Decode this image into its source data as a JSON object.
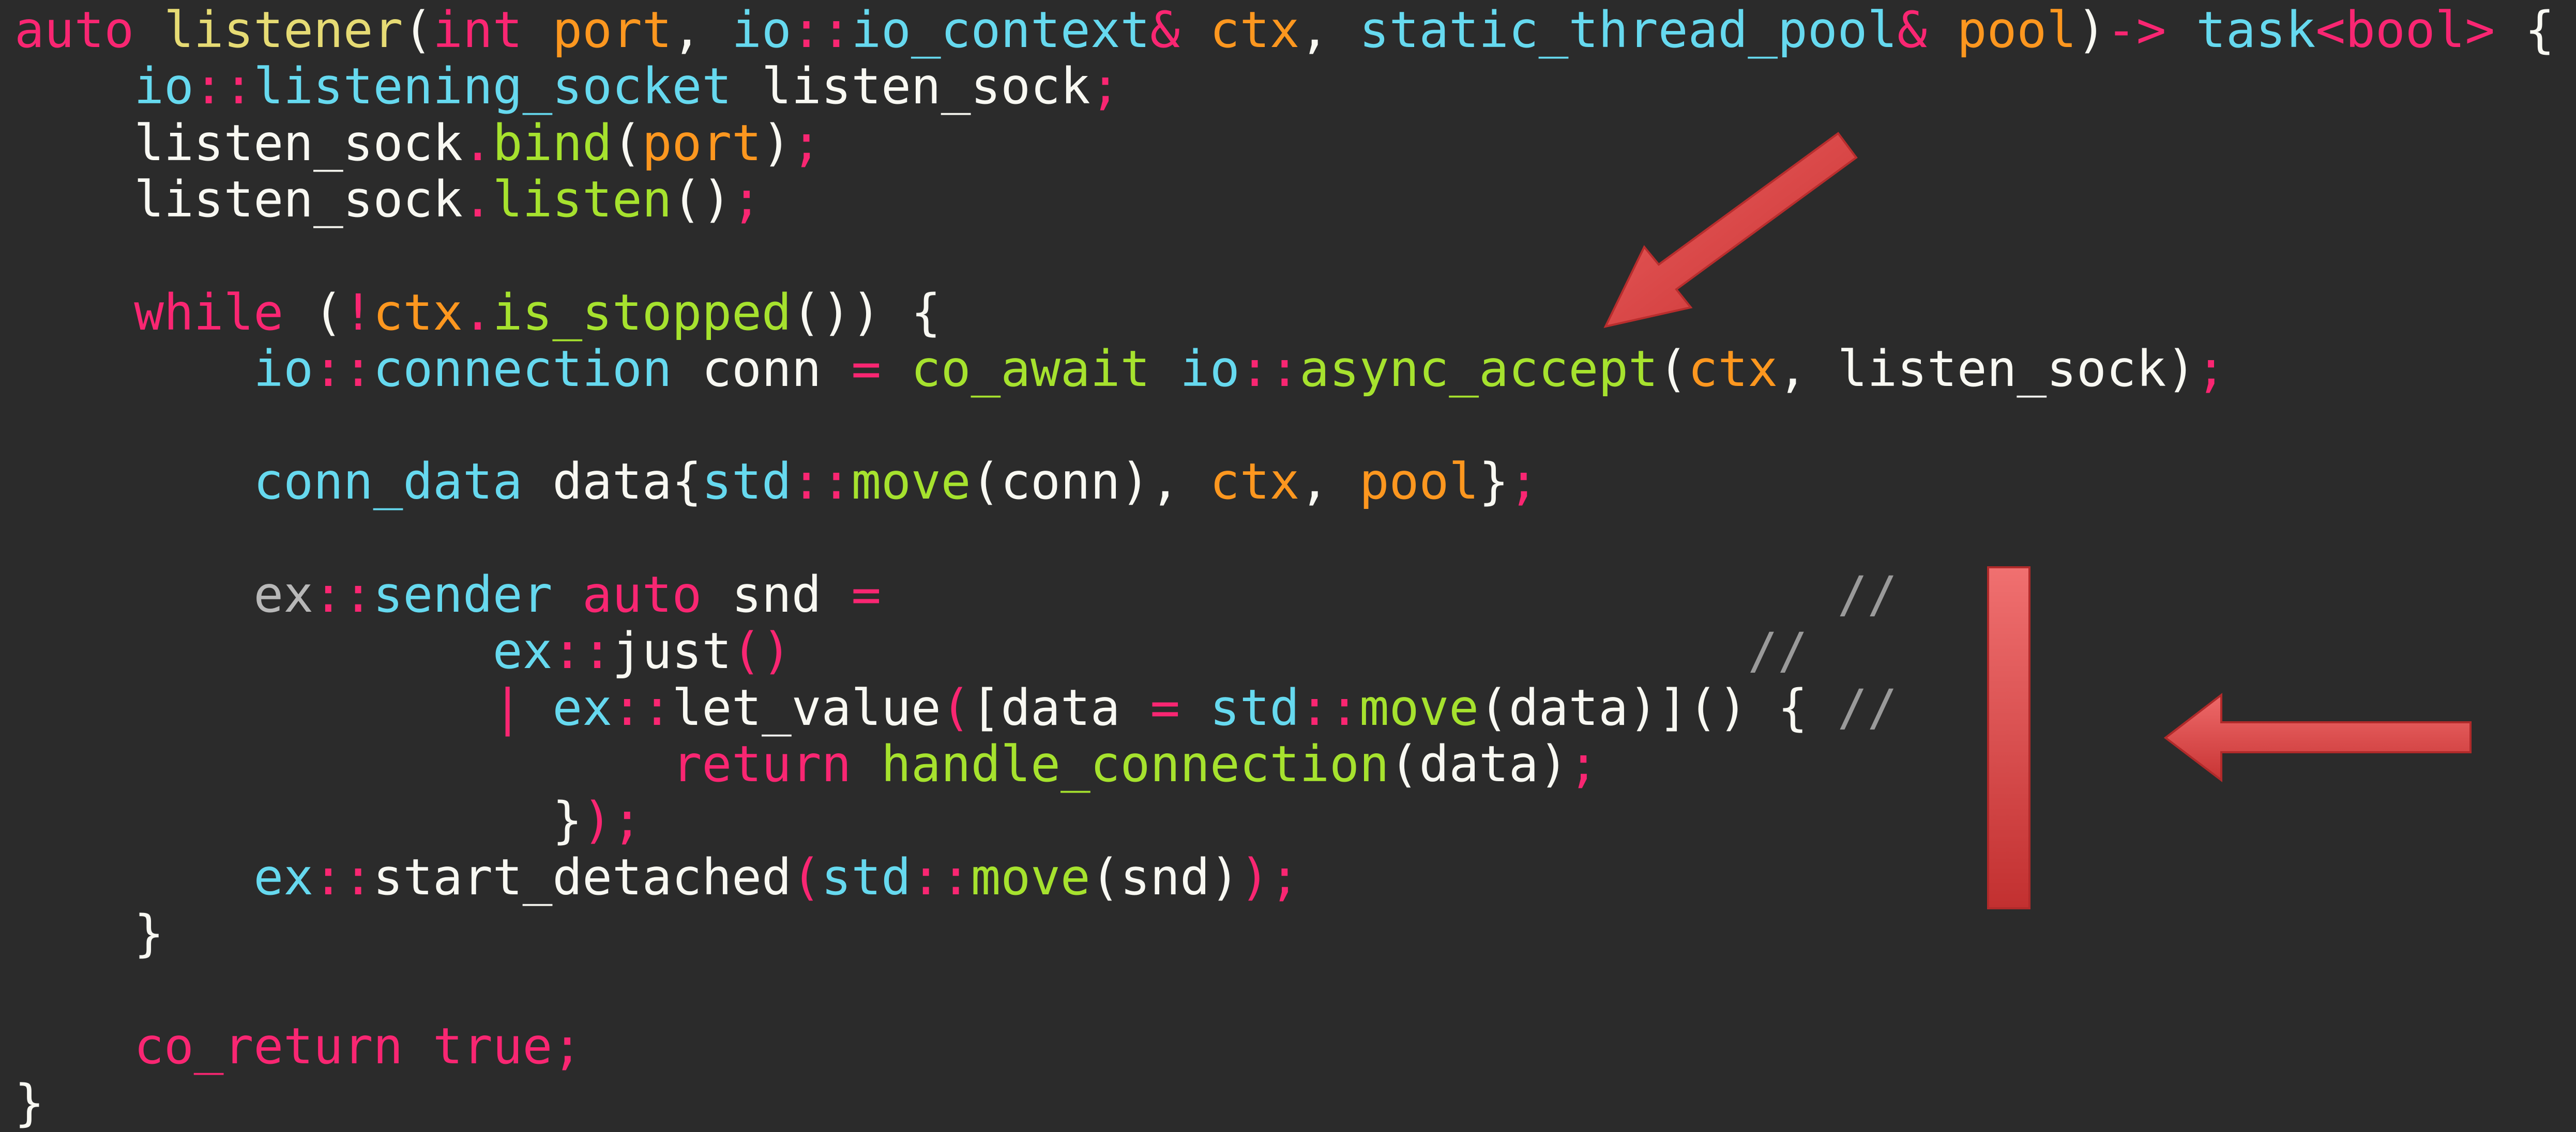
{
  "colors": {
    "background": "#2b2b2b",
    "keyword": "#f92672",
    "type": "#66d9ef",
    "function": "#a6e22e",
    "parameter": "#fd971f",
    "plain": "#f8f8f2",
    "comment": "#9a9a9a",
    "annotation": "#d83c3c"
  },
  "code_lines": [
    {
      "indent": 0,
      "tokens": [
        {
          "t": "auto",
          "c": "kw"
        },
        {
          "t": " ",
          "c": "pl"
        },
        {
          "t": "listener",
          "c": "nm"
        },
        {
          "t": "(",
          "c": "pl"
        },
        {
          "t": "int",
          "c": "kw"
        },
        {
          "t": " ",
          "c": "pl"
        },
        {
          "t": "port",
          "c": "pa"
        },
        {
          "t": ", ",
          "c": "pl"
        },
        {
          "t": "io",
          "c": "ty"
        },
        {
          "t": "::",
          "c": "op"
        },
        {
          "t": "io_context",
          "c": "ty"
        },
        {
          "t": "&",
          "c": "op"
        },
        {
          "t": " ",
          "c": "pl"
        },
        {
          "t": "ctx",
          "c": "pa"
        },
        {
          "t": ", ",
          "c": "pl"
        },
        {
          "t": "static_thread_pool",
          "c": "ty"
        },
        {
          "t": "&",
          "c": "op"
        },
        {
          "t": " ",
          "c": "pl"
        },
        {
          "t": "pool",
          "c": "pa"
        },
        {
          "t": ")",
          "c": "pl"
        },
        {
          "t": "-> ",
          "c": "op"
        },
        {
          "t": "task",
          "c": "ty"
        },
        {
          "t": "<bool>",
          "c": "kw"
        },
        {
          "t": " {",
          "c": "pl"
        }
      ]
    },
    {
      "indent": 4,
      "tokens": [
        {
          "t": "io",
          "c": "ty"
        },
        {
          "t": "::",
          "c": "op"
        },
        {
          "t": "listening_socket",
          "c": "ty"
        },
        {
          "t": " listen_sock",
          "c": "pl"
        },
        {
          "t": ";",
          "c": "op"
        }
      ]
    },
    {
      "indent": 4,
      "tokens": [
        {
          "t": "listen_sock",
          "c": "pl"
        },
        {
          "t": ".",
          "c": "op"
        },
        {
          "t": "bind",
          "c": "fn"
        },
        {
          "t": "(",
          "c": "pl"
        },
        {
          "t": "port",
          "c": "pa"
        },
        {
          "t": ")",
          "c": "pl"
        },
        {
          "t": ";",
          "c": "op"
        }
      ]
    },
    {
      "indent": 4,
      "tokens": [
        {
          "t": "listen_sock",
          "c": "pl"
        },
        {
          "t": ".",
          "c": "op"
        },
        {
          "t": "listen",
          "c": "fn"
        },
        {
          "t": "()",
          "c": "pl"
        },
        {
          "t": ";",
          "c": "op"
        }
      ]
    },
    {
      "indent": 0,
      "tokens": []
    },
    {
      "indent": 4,
      "tokens": [
        {
          "t": "while",
          "c": "kw"
        },
        {
          "t": " (",
          "c": "pl"
        },
        {
          "t": "!",
          "c": "op"
        },
        {
          "t": "ctx",
          "c": "pa"
        },
        {
          "t": ".",
          "c": "op"
        },
        {
          "t": "is_stopped",
          "c": "fn"
        },
        {
          "t": "()) {",
          "c": "pl"
        }
      ]
    },
    {
      "indent": 8,
      "tokens": [
        {
          "t": "io",
          "c": "ty"
        },
        {
          "t": "::",
          "c": "op"
        },
        {
          "t": "connection",
          "c": "ty"
        },
        {
          "t": " conn ",
          "c": "pl"
        },
        {
          "t": "=",
          "c": "op"
        },
        {
          "t": " ",
          "c": "pl"
        },
        {
          "t": "co_await",
          "c": "fn"
        },
        {
          "t": " ",
          "c": "pl"
        },
        {
          "t": "io",
          "c": "ty"
        },
        {
          "t": "::",
          "c": "op"
        },
        {
          "t": "async_accept",
          "c": "fn"
        },
        {
          "t": "(",
          "c": "pl"
        },
        {
          "t": "ctx",
          "c": "pa"
        },
        {
          "t": ", listen_sock)",
          "c": "pl"
        },
        {
          "t": ";",
          "c": "op"
        }
      ]
    },
    {
      "indent": 0,
      "tokens": []
    },
    {
      "indent": 8,
      "tokens": [
        {
          "t": "conn_data",
          "c": "ty"
        },
        {
          "t": " data{",
          "c": "pl"
        },
        {
          "t": "std",
          "c": "ty"
        },
        {
          "t": "::",
          "c": "op"
        },
        {
          "t": "move",
          "c": "fn"
        },
        {
          "t": "(conn), ",
          "c": "pl"
        },
        {
          "t": "ctx",
          "c": "pa"
        },
        {
          "t": ", ",
          "c": "pl"
        },
        {
          "t": "pool",
          "c": "pa"
        },
        {
          "t": "}",
          "c": "pl"
        },
        {
          "t": ";",
          "c": "op"
        }
      ]
    },
    {
      "indent": 0,
      "tokens": []
    },
    {
      "indent": 8,
      "tokens": [
        {
          "t": "ex",
          "c": "ns"
        },
        {
          "t": "::",
          "c": "op"
        },
        {
          "t": "sender",
          "c": "ty"
        },
        {
          "t": " ",
          "c": "pl"
        },
        {
          "t": "auto",
          "c": "kw"
        },
        {
          "t": " snd ",
          "c": "pl"
        },
        {
          "t": "=",
          "c": "op"
        },
        {
          "t": "                                //",
          "c": "cm"
        }
      ]
    },
    {
      "indent": 16,
      "tokens": [
        {
          "t": "ex",
          "c": "ty"
        },
        {
          "t": "::",
          "c": "op"
        },
        {
          "t": "just",
          "c": "pl"
        },
        {
          "t": "()",
          "c": "op"
        },
        {
          "t": "                                //",
          "c": "cm"
        }
      ]
    },
    {
      "indent": 16,
      "tokens": [
        {
          "t": "| ",
          "c": "op"
        },
        {
          "t": "ex",
          "c": "ty"
        },
        {
          "t": "::",
          "c": "op"
        },
        {
          "t": "let_value",
          "c": "pl"
        },
        {
          "t": "(",
          "c": "op"
        },
        {
          "t": "[data ",
          "c": "pl"
        },
        {
          "t": "=",
          "c": "op"
        },
        {
          "t": " ",
          "c": "pl"
        },
        {
          "t": "std",
          "c": "ty"
        },
        {
          "t": "::",
          "c": "op"
        },
        {
          "t": "move",
          "c": "fn"
        },
        {
          "t": "(data)]() { ",
          "c": "pl"
        },
        {
          "t": "//",
          "c": "cm"
        }
      ]
    },
    {
      "indent": 22,
      "tokens": [
        {
          "t": "return",
          "c": "kw"
        },
        {
          "t": " ",
          "c": "pl"
        },
        {
          "t": "handle_connection",
          "c": "fn"
        },
        {
          "t": "(data)",
          "c": "pl"
        },
        {
          "t": ";",
          "c": "op"
        }
      ]
    },
    {
      "indent": 18,
      "tokens": [
        {
          "t": "}",
          "c": "pl"
        },
        {
          "t": ");",
          "c": "op"
        }
      ]
    },
    {
      "indent": 8,
      "tokens": [
        {
          "t": "ex",
          "c": "ty"
        },
        {
          "t": "::",
          "c": "op"
        },
        {
          "t": "start_detached",
          "c": "pl"
        },
        {
          "t": "(",
          "c": "op"
        },
        {
          "t": "std",
          "c": "ty"
        },
        {
          "t": "::",
          "c": "op"
        },
        {
          "t": "move",
          "c": "fn"
        },
        {
          "t": "(snd)",
          "c": "pl"
        },
        {
          "t": ");",
          "c": "op"
        }
      ]
    },
    {
      "indent": 4,
      "tokens": [
        {
          "t": "}",
          "c": "pl"
        }
      ]
    },
    {
      "indent": 0,
      "tokens": []
    },
    {
      "indent": 4,
      "tokens": [
        {
          "t": "co_return",
          "c": "kw"
        },
        {
          "t": " ",
          "c": "pl"
        },
        {
          "t": "true",
          "c": "kw"
        },
        {
          "t": ";",
          "c": "op"
        }
      ]
    },
    {
      "indent": 0,
      "tokens": [
        {
          "t": "}",
          "c": "pl"
        }
      ]
    }
  ]
}
